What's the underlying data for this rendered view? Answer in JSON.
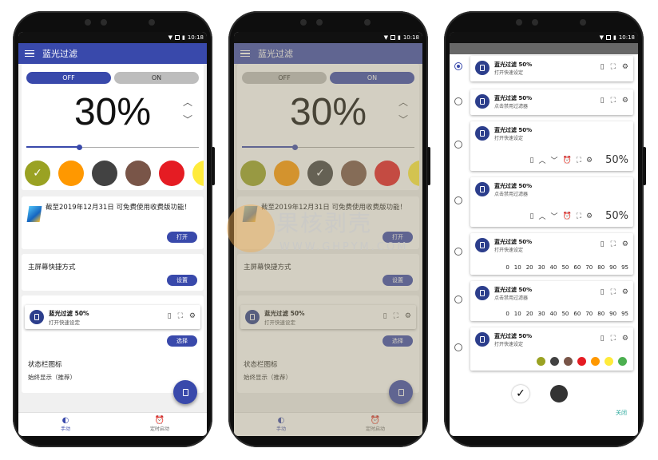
{
  "status": {
    "time": "10:18"
  },
  "app": {
    "title": "蓝光过滤"
  },
  "toggle": {
    "off": "OFF",
    "on": "ON"
  },
  "intensity": {
    "value": "30%",
    "level": 0.3
  },
  "promo": {
    "text": "截至2019年12月31日 可免费使用收费版功能！",
    "button": "打开"
  },
  "shortcut": {
    "title": "主屏幕快捷方式",
    "button": "设置"
  },
  "widget": {
    "title": "蓝光过滤 50%",
    "subtitle": "打开快速设定",
    "button": "选择"
  },
  "statusbar_icon": {
    "title": "状态栏图标",
    "subtitle": "始终显示（推荐）"
  },
  "nav": {
    "manual": "手动",
    "timer": "定时启动"
  },
  "swatch_colors": [
    "#9aa223",
    "#ff9800",
    "#424242",
    "#795548",
    "#e51c23",
    "#ffeb3b"
  ],
  "dialog": {
    "rows": [
      {
        "title": "蓝光过滤 50%",
        "subtitle": "打开快速设定",
        "selected": true
      },
      {
        "title": "蓝光过滤 50%",
        "subtitle": "点击禁用过滤器",
        "selected": false
      },
      {
        "title": "蓝光过滤 50%",
        "subtitle": "打开快速设定",
        "selected": false,
        "percent": "50%"
      },
      {
        "title": "蓝光过滤 50%",
        "subtitle": "点击禁用过滤器",
        "selected": false,
        "percent": "50%"
      },
      {
        "title": "蓝光过滤 50%",
        "subtitle": "打开快速设定",
        "selected": false
      },
      {
        "title": "蓝光过滤 50%",
        "subtitle": "点击禁用过滤器",
        "selected": false
      },
      {
        "title": "蓝光过滤 50%",
        "subtitle": "打开快速设定",
        "selected": false
      }
    ],
    "levels": [
      "0",
      "10",
      "20",
      "30",
      "40",
      "50",
      "60",
      "70",
      "80",
      "90",
      "95"
    ],
    "dot_colors": [
      "#9aa223",
      "#424242",
      "#795548",
      "#e51c23",
      "#ff9800",
      "#ffeb3b",
      "#4caf50"
    ],
    "close": "关闭"
  },
  "watermark": {
    "text": "果核剥壳",
    "url": "WWW.GHPYM.COM"
  }
}
